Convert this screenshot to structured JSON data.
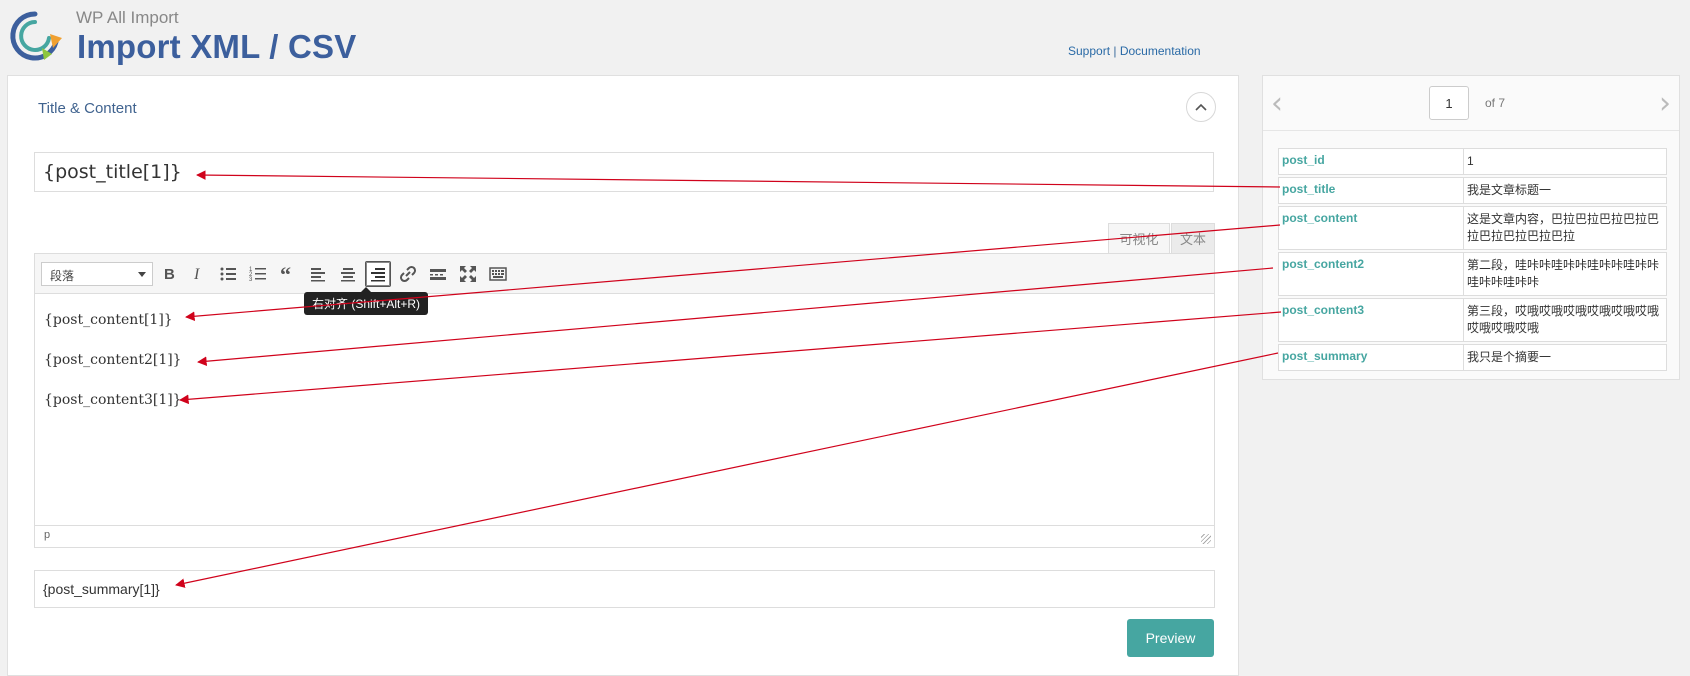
{
  "header": {
    "app_name": "WP All Import",
    "page_title": "Import XML / CSV",
    "support_link": "Support",
    "separator": "|",
    "documentation_link": "Documentation"
  },
  "section": {
    "title": "Title & Content"
  },
  "fields": {
    "post_title": "{post_title[1]}",
    "post_summary": "{post_summary[1]}"
  },
  "editor": {
    "tab_visual": "可视化",
    "tab_text": "文本",
    "format_select": "段落",
    "tooltip": "右对齐 (Shift+Alt+R)",
    "status_path": "p",
    "lines": [
      "{post_content[1]}",
      "{post_content2[1]}",
      "{post_content3[1]}"
    ]
  },
  "actions": {
    "preview": "Preview"
  },
  "record_nav": {
    "current_page": "1",
    "of_label": "of 7"
  },
  "record": [
    {
      "key": "post_id",
      "value": "1"
    },
    {
      "key": "post_title",
      "value": "我是文章标题一"
    },
    {
      "key": "post_content",
      "value": "这是文章内容，巴拉巴拉巴拉巴拉巴拉巴拉巴拉巴拉巴拉"
    },
    {
      "key": "post_content2",
      "value": "第二段，哇咔咔哇咔咔哇咔咔哇咔咔哇咔咔哇咔咔"
    },
    {
      "key": "post_content3",
      "value": "第三段，哎哦哎哦哎哦哎哦哎哦哎哦哎哦哎哦哎哦"
    },
    {
      "key": "post_summary",
      "value": "我只是个摘要一"
    }
  ],
  "colors": {
    "accent_teal": "#46a6a1",
    "title_blue": "#3c5f9d",
    "annotation_red": "#d0021b"
  }
}
